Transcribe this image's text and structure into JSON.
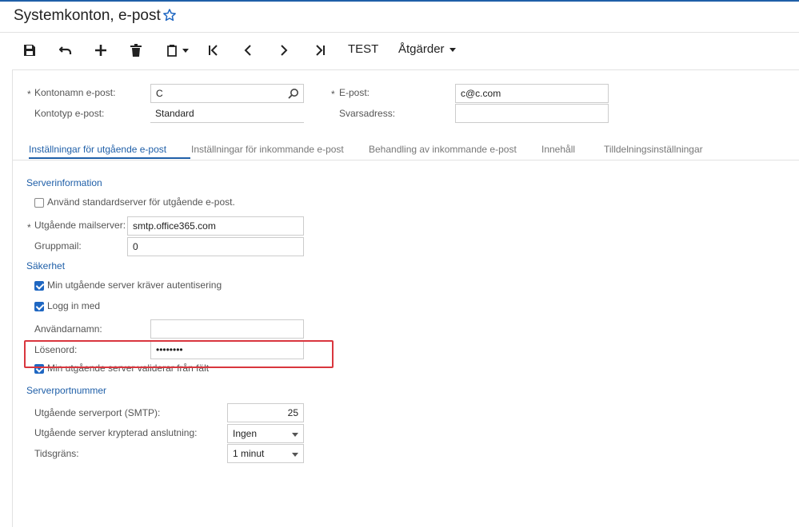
{
  "title": "Systemkonton, e-post",
  "toolbar": {
    "test_label": "TEST",
    "actions_label": "Åtgärder"
  },
  "header_form": {
    "account_name_label": "Kontonamn e-post:",
    "account_name_value": "C",
    "account_type_label": "Kontotyp e-post:",
    "account_type_value": "Standard",
    "email_label": "E-post:",
    "email_value": "c@c.com",
    "reply_label": "Svarsadress:",
    "reply_value": ""
  },
  "required_marker": "*",
  "tabs": [
    {
      "label": "Inställningar för utgående e-post"
    },
    {
      "label": "Inställningar för inkommande e-post"
    },
    {
      "label": "Behandling av inkommande e-post"
    },
    {
      "label": "Innehåll"
    },
    {
      "label": "Tilldelningsinställningar"
    }
  ],
  "server_info": {
    "heading": "Serverinformation",
    "use_default_label": "Använd standardserver för utgående e-post.",
    "use_default_checked": false,
    "outgoing_server_label": "Utgående mailserver:",
    "outgoing_server_value": "smtp.office365.com",
    "group_mail_label": "Gruppmail:",
    "group_mail_value": "0"
  },
  "security": {
    "heading": "Säkerhet",
    "requires_auth_label": "Min utgående server kräver autentisering",
    "requires_auth_checked": true,
    "login_with_label": "Logg in med",
    "login_with_checked": true,
    "username_label": "Användarnamn:",
    "username_value": "",
    "password_label": "Lösenord:",
    "password_value": "••••••••",
    "validates_label": "Min utgående server validerar från fält",
    "validates_checked": true
  },
  "ports": {
    "heading": "Serverportnummer",
    "smtp_port_label": "Utgående serverport (SMTP):",
    "smtp_port_value": "25",
    "encryption_label": "Utgående server krypterad anslutning:",
    "encryption_value": "Ingen",
    "timeout_label": "Tidsgräns:",
    "timeout_value": "1 minut"
  },
  "icons": {
    "star": "star-icon",
    "save": "save-icon",
    "undo": "undo-icon",
    "add": "plus-icon",
    "delete": "trash-icon",
    "copy": "clipboard-icon",
    "first": "first-page-icon",
    "prev": "chevron-left-icon",
    "next": "chevron-right-icon",
    "last": "last-page-icon",
    "search": "search-icon"
  },
  "colors": {
    "accent": "#1f5fa8",
    "checkbox": "#1f67c2",
    "highlight": "#d9363e"
  }
}
